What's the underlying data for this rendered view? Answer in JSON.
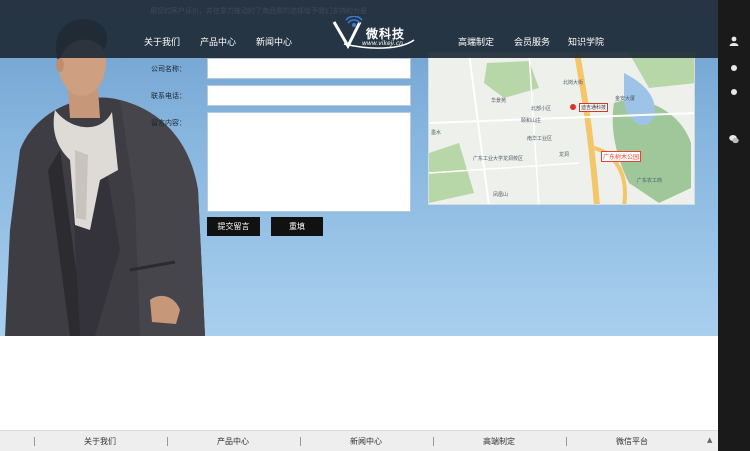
{
  "header": {
    "intro": "用您的客户评价，并在意力推动的了商品质的选择给予我们支持的为是",
    "nav_left": [
      "关于我们",
      "产品中心",
      "新闻中心"
    ],
    "nav_right": [
      "高端制定",
      "会员服务",
      "知识学院"
    ],
    "logo_text": "微科技",
    "logo_url": "www.vikeji.cn"
  },
  "form": {
    "company_label": "公司名称：",
    "phone_label": "联系电话：",
    "message_label": "留言内容：",
    "company_value": "",
    "phone_value": "",
    "message_value": "",
    "submit_label": "提交留言",
    "reset_label": "重填"
  },
  "map": {
    "labels": [
      "北岗大街",
      "华景苑",
      "金安大厦",
      "北部小区",
      "颐和山庄",
      "南华工业区",
      "广东工业大学龙洞校区",
      "龙洞",
      "广东树木公园",
      "广东农工商",
      "墨水",
      "凤凰山"
    ],
    "marker_label": "迪吉通科技"
  },
  "bottom": {
    "items": [
      "关于我们",
      "产品中心",
      "新闻中心",
      "高端制定",
      "微信平台"
    ],
    "top_arrow": "▲"
  },
  "sidebar": {
    "icons": [
      "user-icon",
      "dot-icon",
      "dot-icon",
      "wechat-icon"
    ]
  },
  "colors": {
    "header_bg": "#202c38",
    "sky_top": "#6d9fcd",
    "sky_bottom": "#a9cfee",
    "button_bg": "#111111",
    "sidebar_bg": "#1a1a1a",
    "park_red": "#e6442e"
  }
}
